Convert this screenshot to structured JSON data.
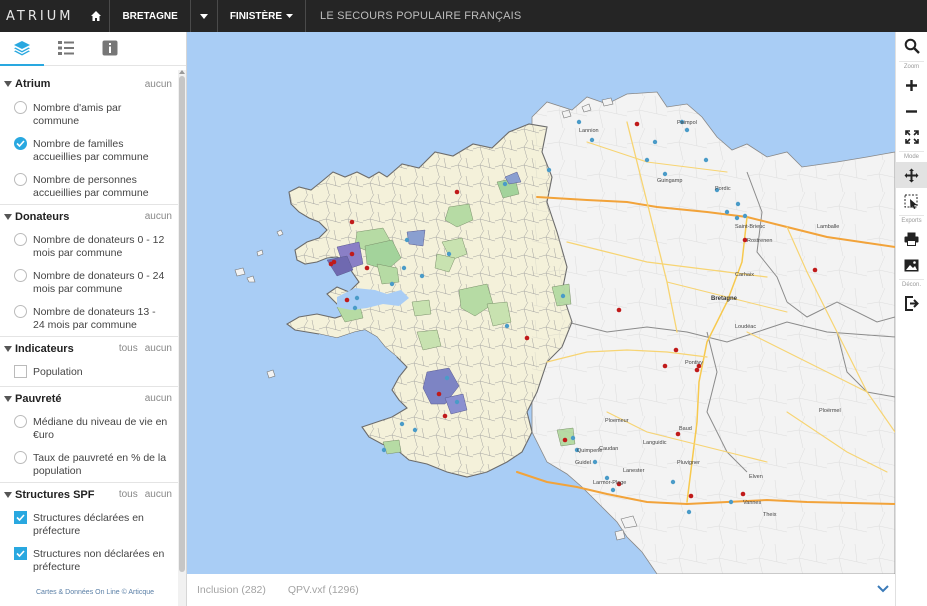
{
  "topbar": {
    "logo": "ATRIUM",
    "region": "BRETAGNE",
    "department": "FINISTÈRE",
    "organization": "LE SECOURS POPULAIRE FRANÇAIS"
  },
  "sidebar": {
    "tabs": [
      "layers-icon",
      "legend-icon",
      "info-icon"
    ],
    "sections": [
      {
        "title": "Atrium",
        "links": [
          "aucun"
        ],
        "options": [
          {
            "label": "Nombre d'amis par commune",
            "type": "radio",
            "checked": false
          },
          {
            "label": "Nombre de familles accueillies par commune",
            "type": "radio",
            "checked": true
          },
          {
            "label": "Nombre de personnes accueillies par commune",
            "type": "radio",
            "checked": false
          }
        ]
      },
      {
        "title": "Donateurs",
        "links": [
          "aucun"
        ],
        "options": [
          {
            "label": "Nombre de donateurs 0 - 12 mois par commune",
            "type": "radio",
            "checked": false
          },
          {
            "label": "Nombre de donateurs 0 - 24 mois par commune",
            "type": "radio",
            "checked": false
          },
          {
            "label": "Nombre de donateurs 13 - 24 mois par commune",
            "type": "radio",
            "checked": false
          }
        ]
      },
      {
        "title": "Indicateurs",
        "links": [
          "tous",
          "aucun"
        ],
        "options": [
          {
            "label": "Population",
            "type": "checkbox",
            "checked": false
          }
        ]
      },
      {
        "title": "Pauvreté",
        "links": [
          "aucun"
        ],
        "options": [
          {
            "label": "Médiane du niveau de vie en €uro",
            "type": "radio",
            "checked": false
          },
          {
            "label": "Taux de pauvreté en % de la population",
            "type": "radio",
            "checked": false
          }
        ]
      },
      {
        "title": "Structures SPF",
        "links": [
          "tous",
          "aucun"
        ],
        "options": [
          {
            "label": "Structures déclarées en préfecture",
            "type": "checkbox",
            "checked": true
          },
          {
            "label": "Structures non déclarées en préfecture",
            "type": "checkbox",
            "checked": true
          }
        ]
      }
    ],
    "credits": "Cartes & Données On Line © Articque"
  },
  "map": {
    "labels": {
      "lannion": "Lannion",
      "paimpol": "Paimpol",
      "guingamp": "Guingamp",
      "pordic": "Pordic",
      "saint_brieuc": "Saint-Brieuc",
      "lamballe": "Lamballe",
      "loudeac": "Loudéac",
      "bretagne": "Bretagne",
      "pontivy": "Pontivy",
      "ploermel": "Ploërmel",
      "ploemeur": "Ploemeur",
      "quimperle": "Quimperlé",
      "guidel": "Guidel",
      "caudan": "Caudan",
      "lanester": "Lanester",
      "larmor": "Larmor-Plage",
      "languidic": "Languidic",
      "pluvigner": "Pluvigner",
      "elven": "Elven",
      "vannes": "Vannes",
      "theix": "Theix",
      "baud": "Baud",
      "rostrenen": "Rostrenen",
      "carhaix": "Carhaix"
    }
  },
  "bottombar": {
    "items": [
      "Inclusion (282)",
      "QPV.vxf (1296)"
    ]
  },
  "toolbar": {
    "zoom_label": "Zoom",
    "mode_label": "Mode",
    "exports_label": "Exports",
    "deco_label": "Décon."
  },
  "colors": {
    "accent": "#29a8e0",
    "sea": "#a9cdf5",
    "finistere_fill": "#f3f0dc",
    "land": "#f2f2f2",
    "highway": "#f2a33a",
    "road": "#f7d472",
    "green_zone": "#b6dba4",
    "purple_zone": "#8a7fc6",
    "structure_declared": "#c01a1a",
    "structure_other": "#4a9bc8"
  }
}
